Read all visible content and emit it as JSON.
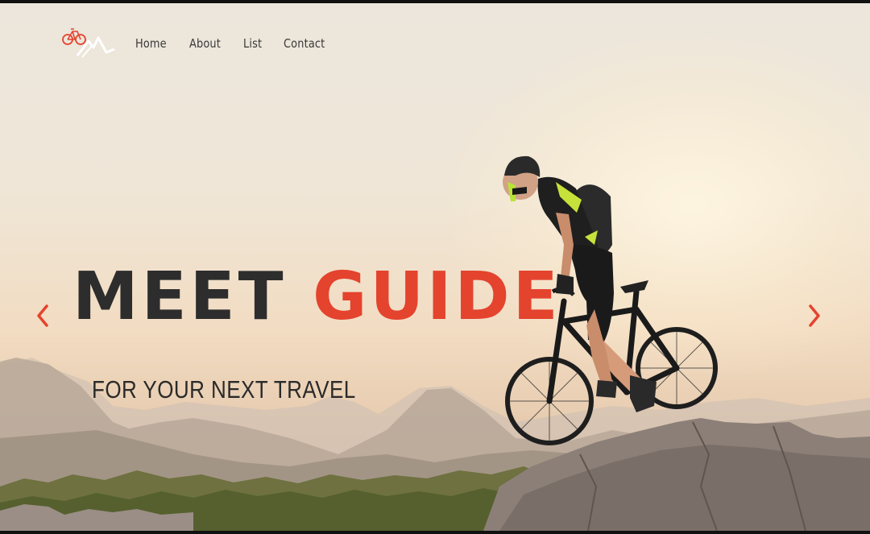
{
  "nav": {
    "logo_icon": "bike-mountain-logo-icon",
    "links": [
      "Home",
      "About",
      "List",
      "Contact"
    ]
  },
  "hero": {
    "headline_part1": "MEET",
    "headline_part2": "GUIDE",
    "subline": "FOR YOUR NEXT TRAVEL",
    "prev_icon": "chevron-left-icon",
    "next_icon": "chevron-right-icon"
  },
  "colors": {
    "accent": "#e4432e",
    "text_dark": "#2d2d2d"
  }
}
